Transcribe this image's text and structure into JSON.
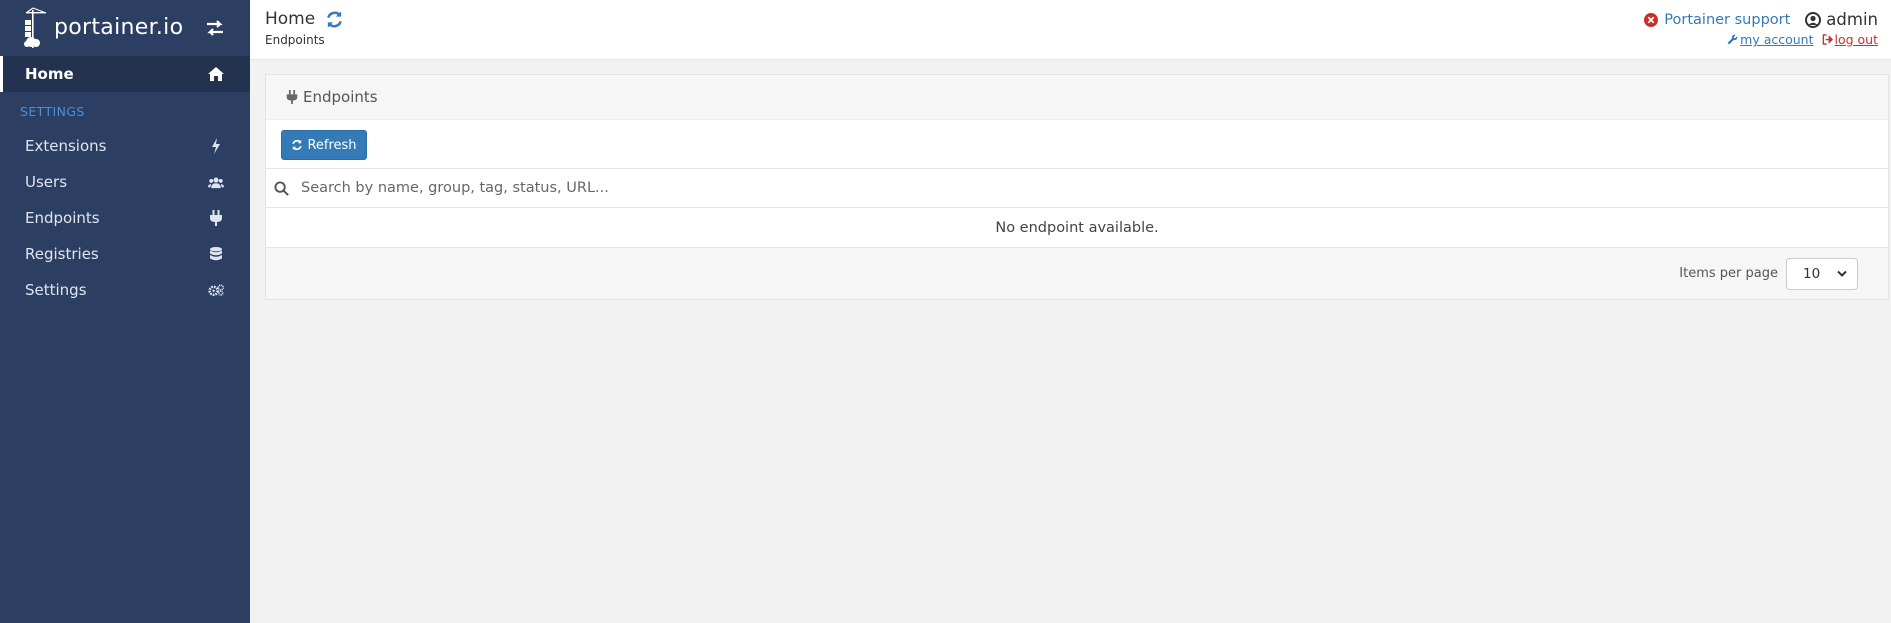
{
  "sidebar": {
    "brand": "portainer.io",
    "items": [
      {
        "label": "Home",
        "icon": "home-icon",
        "active": true
      },
      {
        "label": "Extensions",
        "icon": "bolt-icon"
      },
      {
        "label": "Users",
        "icon": "users-icon"
      },
      {
        "label": "Endpoints",
        "icon": "plug-icon"
      },
      {
        "label": "Registries",
        "icon": "database-icon"
      },
      {
        "label": "Settings",
        "icon": "cogs-icon"
      }
    ],
    "section_header": "SETTINGS"
  },
  "header": {
    "title": "Home",
    "breadcrumb": "Endpoints",
    "support_label": "Portainer support",
    "username": "admin",
    "my_account_label": "my account",
    "log_out_label": "log out"
  },
  "panel": {
    "title": "Endpoints",
    "refresh_label": "Refresh",
    "search_placeholder": "Search by name, group, tag, status, URL...",
    "empty_message": "No endpoint available.",
    "items_per_page_label": "Items per page",
    "items_per_page_value": "10"
  },
  "colors": {
    "sidebar_bg": "#2d3e63",
    "accent": "#337ab7",
    "danger": "#c9302c"
  }
}
